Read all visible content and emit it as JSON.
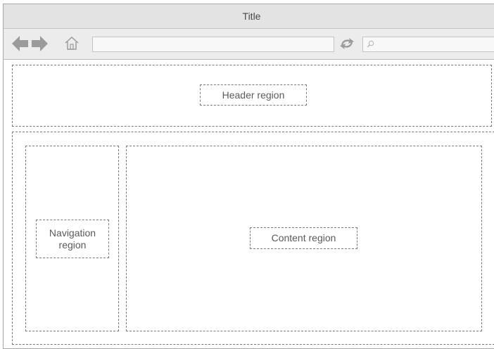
{
  "window": {
    "title": "Title"
  },
  "toolbar": {
    "back_icon": "left-arrow-icon",
    "forward_icon": "right-arrow-icon",
    "home_icon": "home-icon",
    "url_value": "",
    "refresh_icon": "refresh-icon",
    "search_value": "",
    "search_icon": "search-icon"
  },
  "regions": {
    "header": "Header region",
    "navigation": "Navigation\nregion",
    "content": "Content region"
  },
  "colors": {
    "titlebar": "#e3e3e3",
    "toolbar": "#ececec",
    "icon_gray": "#9b9b9b",
    "border": "#7a7a7a"
  }
}
